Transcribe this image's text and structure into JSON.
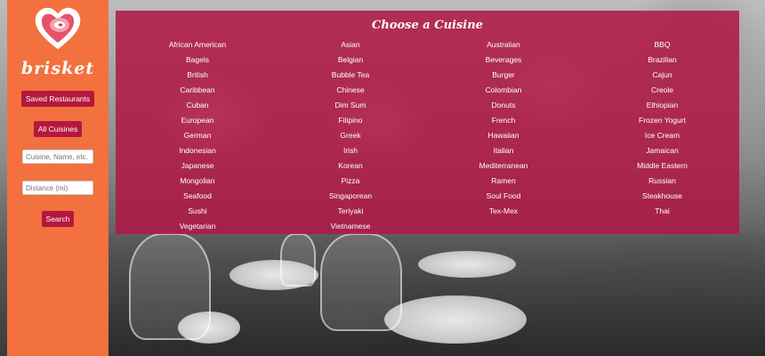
{
  "app": {
    "brand": "brisket",
    "brand_color": "#f2713f",
    "accent_color": "#b5173d",
    "logo_icon": "heart-meat-icon"
  },
  "sidebar": {
    "saved_label": "Saved Restaurants",
    "all_label": "All Cuisines",
    "cuisine_placeholder": "Cuisine, Name, etc.",
    "distance_placeholder": "Distance (mi)",
    "search_label": "Search"
  },
  "panel": {
    "title": "Choose a Cuisine",
    "overlay_color": "#b01646"
  },
  "cuisines": [
    "African American",
    "Asian",
    "Australian",
    "BBQ",
    "Bagels",
    "Belgian",
    "Beverages",
    "Brazilian",
    "British",
    "Bubble Tea",
    "Burger",
    "Cajun",
    "Caribbean",
    "Chinese",
    "Colombian",
    "Creole",
    "Cuban",
    "Dim Sum",
    "Donuts",
    "Ethiopian",
    "European",
    "Filipino",
    "French",
    "Frozen Yogurt",
    "German",
    "Greek",
    "Hawaiian",
    "Ice Cream",
    "Indonesian",
    "Irish",
    "Italian",
    "Jamaican",
    "Japanese",
    "Korean",
    "Mediterranean",
    "Middle Eastern",
    "Mongolian",
    "Pizza",
    "Ramen",
    "Russian",
    "Seafood",
    "Singaporean",
    "Soul Food",
    "Steakhouse",
    "Sushi",
    "Teriyaki",
    "Tex-Mex",
    "Thai",
    "Vegetarian",
    "Vietnamese"
  ]
}
